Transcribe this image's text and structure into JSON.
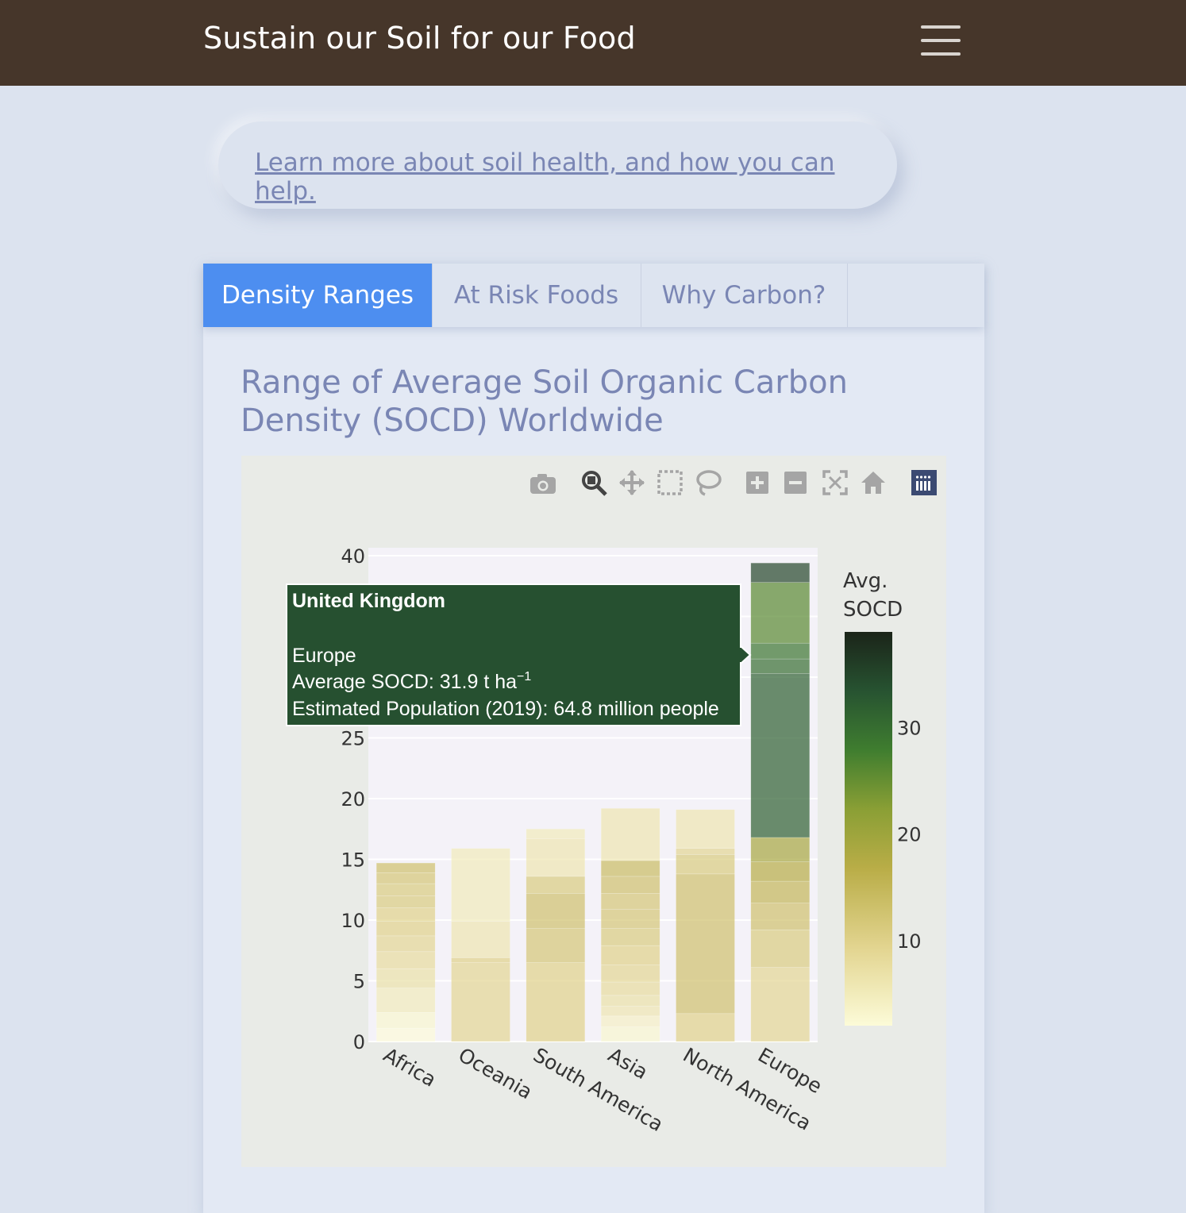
{
  "navbar": {
    "brand": "Sustain our Soil for our Food"
  },
  "link": {
    "text": "Learn more about soil health, and how you can help."
  },
  "tabs": [
    {
      "label": "Density Ranges",
      "active": true
    },
    {
      "label": "At Risk Foods",
      "active": false
    },
    {
      "label": "Why Carbon?",
      "active": false
    }
  ],
  "card": {
    "title": "Range of Average Soil Organic Carbon Density (SOCD) Worldwide"
  },
  "modebar": [
    "camera-icon",
    "zoom-icon",
    "pan-icon",
    "box-select-icon",
    "lasso-select-icon",
    "zoom-in-icon",
    "zoom-out-icon",
    "autoscale-icon",
    "reset-axes-icon",
    "plotly-logo-icon"
  ],
  "tooltip": {
    "country": "United Kingdom",
    "continent": "Europe",
    "socd_prefix": "Average SOCD: 31.9 t ha",
    "socd_sup": "−1",
    "population": "Estimated Population (2019): 64.8 million people"
  },
  "chart_data": {
    "type": "bar",
    "barmode": "stack",
    "categories": [
      "Africa",
      "Oceania",
      "South America",
      "Asia",
      "North America",
      "Europe"
    ],
    "totals": [
      14.7,
      15.9,
      17.5,
      18.2,
      19.1,
      38.4
    ],
    "segments": {
      "Africa": [
        1.1,
        1.3,
        2.0,
        1.6,
        1.4,
        1.3,
        1.2,
        1.1,
        1.0,
        1.0,
        0.9,
        0.8
      ],
      "Oceania": [
        6.5,
        0.4,
        3.0,
        6.0
      ],
      "South America": [
        6.5,
        2.8,
        2.9,
        1.4,
        3.1,
        0.8
      ],
      "Asia": [
        1.2,
        0.9,
        0.8,
        0.9,
        1.1,
        1.4,
        1.6,
        1.4,
        1.6,
        1.3,
        1.4,
        1.3,
        4.3
      ],
      "North America": [
        2.3,
        11.5,
        1.6,
        0.5,
        3.2
      ],
      "Europe": [
        6.1,
        3.1,
        2.2,
        1.8,
        1.6,
        2.0,
        13.5,
        1.2,
        1.3,
        5.0,
        1.6
      ],
      "Europe_top_segment_note": ""
    },
    "segment_socd": {
      "Africa": [
        2,
        3,
        5,
        7,
        8,
        9,
        10,
        10,
        11,
        11,
        12,
        13
      ],
      "Oceania": [
        9,
        10,
        6,
        5
      ],
      "South America": [
        10,
        12,
        13,
        11,
        6,
        5
      ],
      "Asia": [
        3,
        4,
        6,
        7,
        8,
        9,
        10,
        11,
        12,
        12,
        13,
        14,
        6
      ],
      "North America": [
        10,
        13,
        11,
        9,
        6
      ],
      "Europe": [
        9,
        11,
        13,
        15,
        17,
        19,
        31.9,
        30,
        29,
        26,
        35
      ]
    },
    "colorbar": {
      "title": "Avg. SOCD",
      "ticks": [
        10,
        20,
        30
      ],
      "range": [
        2,
        39
      ],
      "colorscale": [
        "#fcfbd8",
        "#d5c46f",
        "#a3a43b",
        "#4f8c2e",
        "#2e6a33",
        "#1f2a1d"
      ]
    },
    "yaxis": {
      "range": [
        0,
        40
      ],
      "ticks": [
        0,
        5,
        10,
        15,
        20,
        25,
        30,
        35,
        40
      ]
    },
    "xlabel": "",
    "ylabel": "",
    "grid": true
  }
}
